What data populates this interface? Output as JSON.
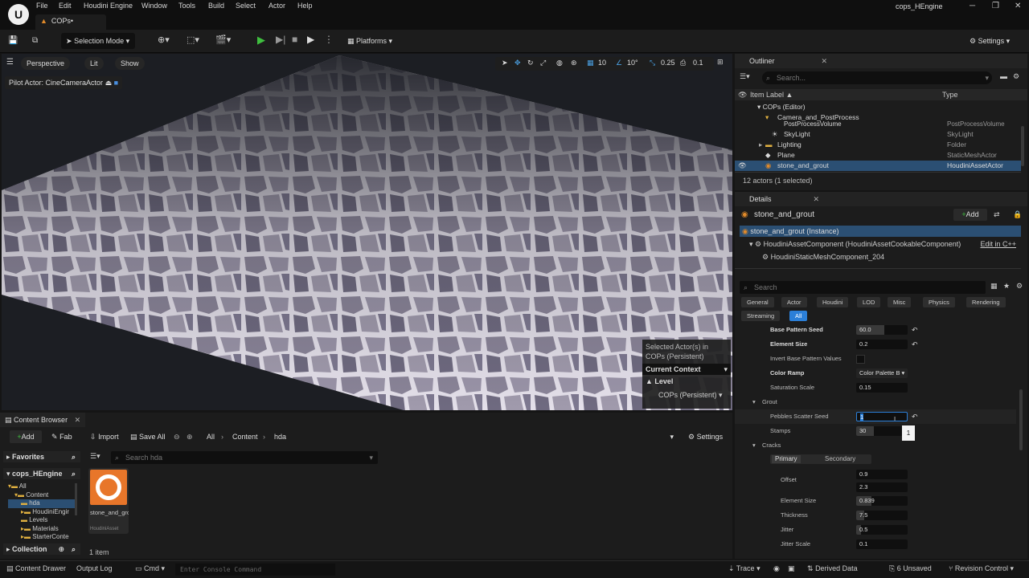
{
  "menubar": {
    "menus": [
      "File",
      "Edit",
      "Houdini Engine",
      "Window",
      "Tools",
      "Build",
      "Select",
      "Actor",
      "Help"
    ],
    "tab": "COPs•",
    "project": "cops_HEngine"
  },
  "toolbar": {
    "selection_mode": "Selection Mode",
    "platforms": "Platforms",
    "settings": "Settings"
  },
  "viewport": {
    "perspective": "Perspective",
    "lit": "Lit",
    "show": "Show",
    "pilot": "Pilot Actor: CineCameraActor",
    "grid_snap": "10",
    "rot_snap": "10°",
    "scale_snap": "0.25",
    "cam_speed": "0.1",
    "context": {
      "line1": "Selected Actor(s) in",
      "line2": "COPs (Persistent)",
      "header": "Current Context",
      "level_label": "Level",
      "level_value": "COPs (Persistent)"
    }
  },
  "outliner": {
    "title": "Outliner",
    "search_placeholder": "Search...",
    "col_label": "Item Label ▲",
    "col_type": "Type",
    "rows": [
      {
        "label": "COPs (Editor)",
        "type": ""
      },
      {
        "label": "Camera_and_PostProcess",
        "type": ""
      },
      {
        "label": "PostProcessVolume",
        "type": "PostProcessVolume"
      },
      {
        "label": "SkyLight",
        "type": "SkyLight"
      },
      {
        "label": "Lighting",
        "type": "Folder"
      },
      {
        "label": "Plane",
        "type": "StaticMeshActor"
      },
      {
        "label": "stone_and_grout",
        "type": "HoudiniAssetActor"
      }
    ],
    "count": "12 actors (1 selected)"
  },
  "details": {
    "title": "Details",
    "actor": "stone_and_grout",
    "add": "Add",
    "instance": "stone_and_grout (Instance)",
    "component": "HoudiniAssetComponent (HoudiniAssetCookableComponent)",
    "edit_cpp": "Edit in C++",
    "mesh_component": "HoudiniStaticMeshComponent_204",
    "search_placeholder": "Search",
    "tabs": [
      "General",
      "Actor",
      "Houdini",
      "LOD",
      "Misc",
      "Physics",
      "Rendering",
      "Streaming",
      "All"
    ],
    "props": {
      "base_pattern_seed": {
        "label": "Base Pattern Seed",
        "value": "60.0",
        "fill": 0.55
      },
      "element_size": {
        "label": "Element Size",
        "value": "0.2",
        "fill": 0
      },
      "invert": {
        "label": "Invert Base Pattern Values"
      },
      "color_ramp": {
        "label": "Color Ramp",
        "value": "Color Palette B"
      },
      "saturation_scale": {
        "label": "Saturation Scale",
        "value": "0.15",
        "fill": 0
      },
      "grout": "Grout",
      "pebbles_seed": {
        "label": "Pebbles Scatter Seed",
        "value": "1"
      },
      "stamps": {
        "label": "Stamps",
        "value": "30",
        "fill": 0.35
      },
      "tooltip": "1",
      "cracks": "Cracks",
      "primary": "Primary",
      "secondary": "Secondary",
      "offset": {
        "label": "Offset",
        "value1": "0.9",
        "value2": "2.3"
      },
      "crack_element_size": {
        "label": "Element Size",
        "value": "0.839",
        "fill": 0.3
      },
      "thickness": {
        "label": "Thickness",
        "value": "7.5",
        "fill": 0.15
      },
      "jitter": {
        "label": "Jitter",
        "value": "0.5",
        "fill": 0.1
      },
      "jitter_scale": {
        "label": "Jitter Scale",
        "value": "0.1",
        "fill": 0
      }
    }
  },
  "content_browser": {
    "title": "Content Browser",
    "add": "Add",
    "fab": "Fab",
    "import": "Import",
    "save_all": "Save All",
    "path": [
      "All",
      "Content",
      "hda"
    ],
    "settings": "Settings",
    "favorites": "Favorites",
    "project": "cops_HEngine",
    "tree": [
      "All",
      "Content",
      "hda",
      "HoudiniEngir",
      "Levels",
      "Materials",
      "StarterConte"
    ],
    "search_placeholder": "Search hda",
    "asset_name": "stone_and_grout",
    "asset_type": "HoudiniAsset",
    "count": "1 item",
    "collection": "Collection"
  },
  "statusbar": {
    "content_drawer": "Content Drawer",
    "output_log": "Output Log",
    "cmd": "Cmd",
    "console_placeholder": "Enter Console Command",
    "trace": "Trace",
    "derived": "Derived Data",
    "unsaved": "6 Unsaved",
    "revision": "Revision Control"
  }
}
